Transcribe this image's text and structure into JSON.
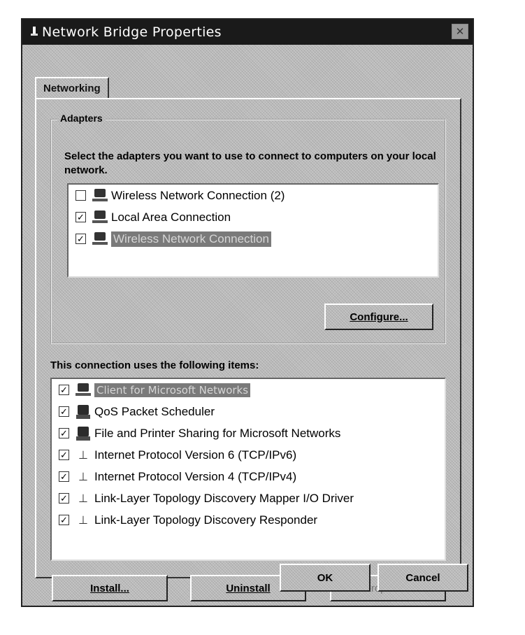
{
  "window": {
    "title": "Network Bridge Properties",
    "close_glyph": "✕"
  },
  "tabs": [
    {
      "label": "Networking",
      "selected": true
    }
  ],
  "adapters": {
    "group_label": "Adapters",
    "instruction": "Select the adapters you want to use to connect to computers on your local network.",
    "items": [
      {
        "label": "Wireless Network Connection (2)",
        "checked": false,
        "selected": false,
        "icon": "network-adapter-icon"
      },
      {
        "label": "Local Area Connection",
        "checked": true,
        "selected": false,
        "icon": "network-adapter-icon"
      },
      {
        "label": "Wireless Network Connection",
        "checked": true,
        "selected": true,
        "icon": "network-adapter-icon"
      }
    ],
    "configure_label": "Configure..."
  },
  "items_section": {
    "caption": "This connection uses the following items:",
    "items": [
      {
        "label": "Client for Microsoft Networks",
        "checked": true,
        "selected": true,
        "icon": "client-icon"
      },
      {
        "label": "QoS Packet Scheduler",
        "checked": true,
        "selected": false,
        "icon": "service-icon"
      },
      {
        "label": "File and Printer Sharing for Microsoft Networks",
        "checked": true,
        "selected": false,
        "icon": "service-icon"
      },
      {
        "label": "Internet Protocol Version 6 (TCP/IPv6)",
        "checked": true,
        "selected": false,
        "icon": "protocol-icon"
      },
      {
        "label": "Internet Protocol Version 4 (TCP/IPv4)",
        "checked": true,
        "selected": false,
        "icon": "protocol-icon"
      },
      {
        "label": "Link-Layer Topology Discovery Mapper I/O Driver",
        "checked": true,
        "selected": false,
        "icon": "protocol-icon"
      },
      {
        "label": "Link-Layer Topology Discovery Responder",
        "checked": true,
        "selected": false,
        "icon": "protocol-icon"
      }
    ],
    "install_label": "Install...",
    "uninstall_label": "Uninstall",
    "properties_label": "Properties",
    "properties_enabled": false
  },
  "dialog_buttons": {
    "ok_label": "OK",
    "cancel_label": "Cancel"
  },
  "glyphs": {
    "check": "✓",
    "protocol": "⊥"
  }
}
